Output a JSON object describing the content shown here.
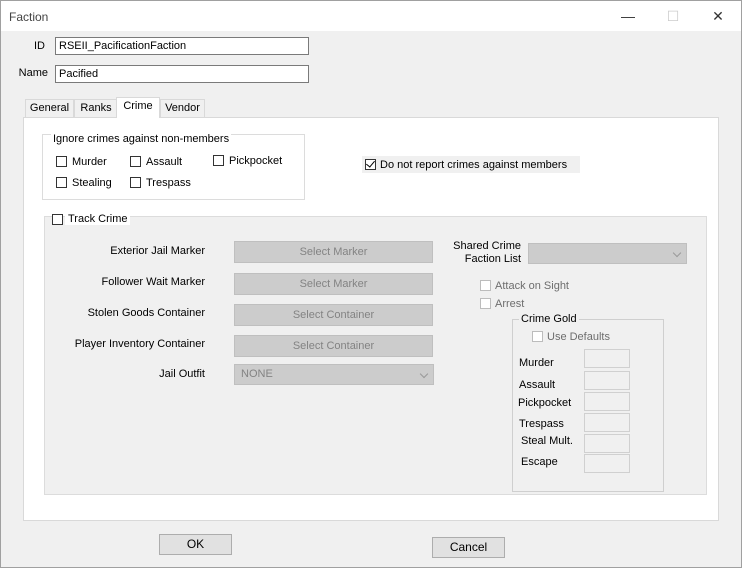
{
  "window": {
    "title": "Faction"
  },
  "fields": {
    "id_label": "ID",
    "id_value": "RSEII_PacificationFaction",
    "name_label": "Name",
    "name_value": "Pacified"
  },
  "tabs": [
    {
      "label": "General"
    },
    {
      "label": "Ranks"
    },
    {
      "label": "Crime"
    },
    {
      "label": "Vendor"
    }
  ],
  "ignore_group": {
    "title": "Ignore crimes against non-members",
    "murder": "Murder",
    "assault": "Assault",
    "pickpocket": "Pickpocket",
    "stealing": "Stealing",
    "trespass": "Trespass"
  },
  "do_not_report": {
    "label": "Do not report crimes against members",
    "checked": true
  },
  "track_crime": {
    "label": "Track Crime",
    "exterior_jail_label": "Exterior Jail Marker",
    "exterior_jail_btn": "Select Marker",
    "follower_wait_label": "Follower Wait Marker",
    "follower_wait_btn": "Select Marker",
    "stolen_goods_label": "Stolen Goods Container",
    "stolen_goods_btn": "Select Container",
    "player_inv_label": "Player Inventory Container",
    "player_inv_btn": "Select Container",
    "jail_outfit_label": "Jail Outfit",
    "jail_outfit_value": "NONE",
    "shared_list_label_1": "Shared Crime",
    "shared_list_label_2": "Faction List",
    "attack_on_sight": "Attack on Sight",
    "arrest": "Arrest"
  },
  "crime_gold": {
    "title": "Crime Gold",
    "use_defaults": "Use Defaults",
    "murder": "Murder",
    "assault": "Assault",
    "pickpocket": "Pickpocket",
    "trespass": "Trespass",
    "steal_mult": "Steal Mult.",
    "escape": "Escape"
  },
  "buttons": {
    "ok": "OK",
    "cancel": "Cancel"
  }
}
